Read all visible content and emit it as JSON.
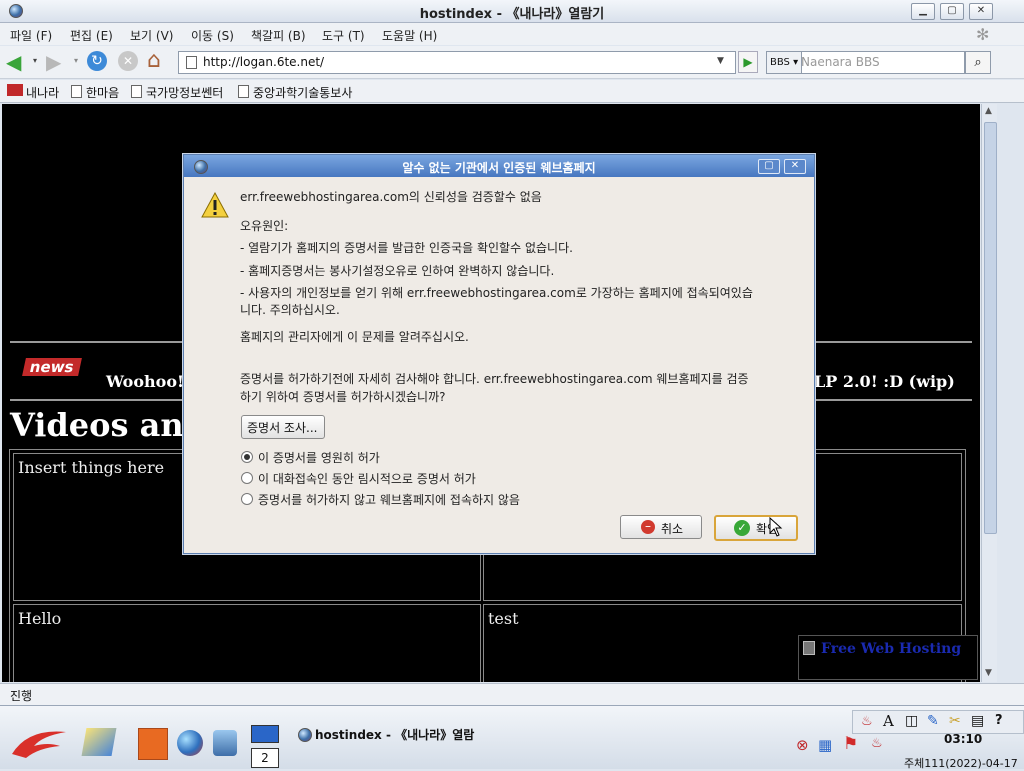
{
  "window": {
    "title": "hostindex - 《내나라》열람기"
  },
  "menu": [
    "파일 (F)",
    "편집 (E)",
    "보기 (V)",
    "이동 (S)",
    "책갈피 (B)",
    "도구 (T)",
    "도움말 (H)"
  ],
  "toolbar": {
    "url": "http://logan.6te.net/",
    "search_engine": "BBS",
    "search_placeholder": "Naenara BBS"
  },
  "bookmarks": [
    "내나라",
    "한마음",
    "국가망정보쎈터",
    "중앙과학기술통보사"
  ],
  "page": {
    "news_label": "news",
    "news_left": "Woohoo!",
    "news_right": "LP 2.0! :D (wip)",
    "heading": "Videos and",
    "cells": [
      "Insert things here",
      "Hello",
      "test"
    ],
    "ad": "Free Web Hosting"
  },
  "status": {
    "text": "진행"
  },
  "dialog": {
    "title": "알수 없는 기관에서 인증된 웨브홈페지",
    "msg_main": "err.freewebhostingarea.com의 신뢰성을 검증할수 없음",
    "reason_header": "오유원인:",
    "reasons": [
      "- 열람기가 홈페지의 증명서를 발급한 인증국을 확인할수 없습니다.",
      "- 홈페지증명서는 봉사기설정오유로 인하여 완벽하지 않습니다.",
      "- 사용자의 개인정보를 얻기 위해 err.freewebhostingarea.com로 가장하는 홈페지에 접속되여있습",
      "니다. 주의하십시오."
    ],
    "notify": "홈페지의 관리자에게 이 문제를 알려주십시오.",
    "check_line1": "증명서를 허가하기전에 자세히 검사해야 합니다. err.freewebhostingarea.com 웨브홈페지를 검증",
    "check_line2": "하기 위하여 증명서를 허가하시겠습니까?",
    "inspect_button": "증명서 조사...",
    "options": [
      "이 증명서를 영원히 허가",
      "이 대화접속인 동안 림시적으로 증명서 허가",
      "증명서를 허가하지 않고 웨브홈페지에 접속하지 않음"
    ],
    "selected_option": 0,
    "cancel_label": "취소",
    "ok_label": "확인"
  },
  "taskbar": {
    "workspace_num": "2",
    "task_label": "hostindex - 《내나라》열람",
    "clock": "03:10",
    "date": "주체111(2022)-04-17"
  }
}
